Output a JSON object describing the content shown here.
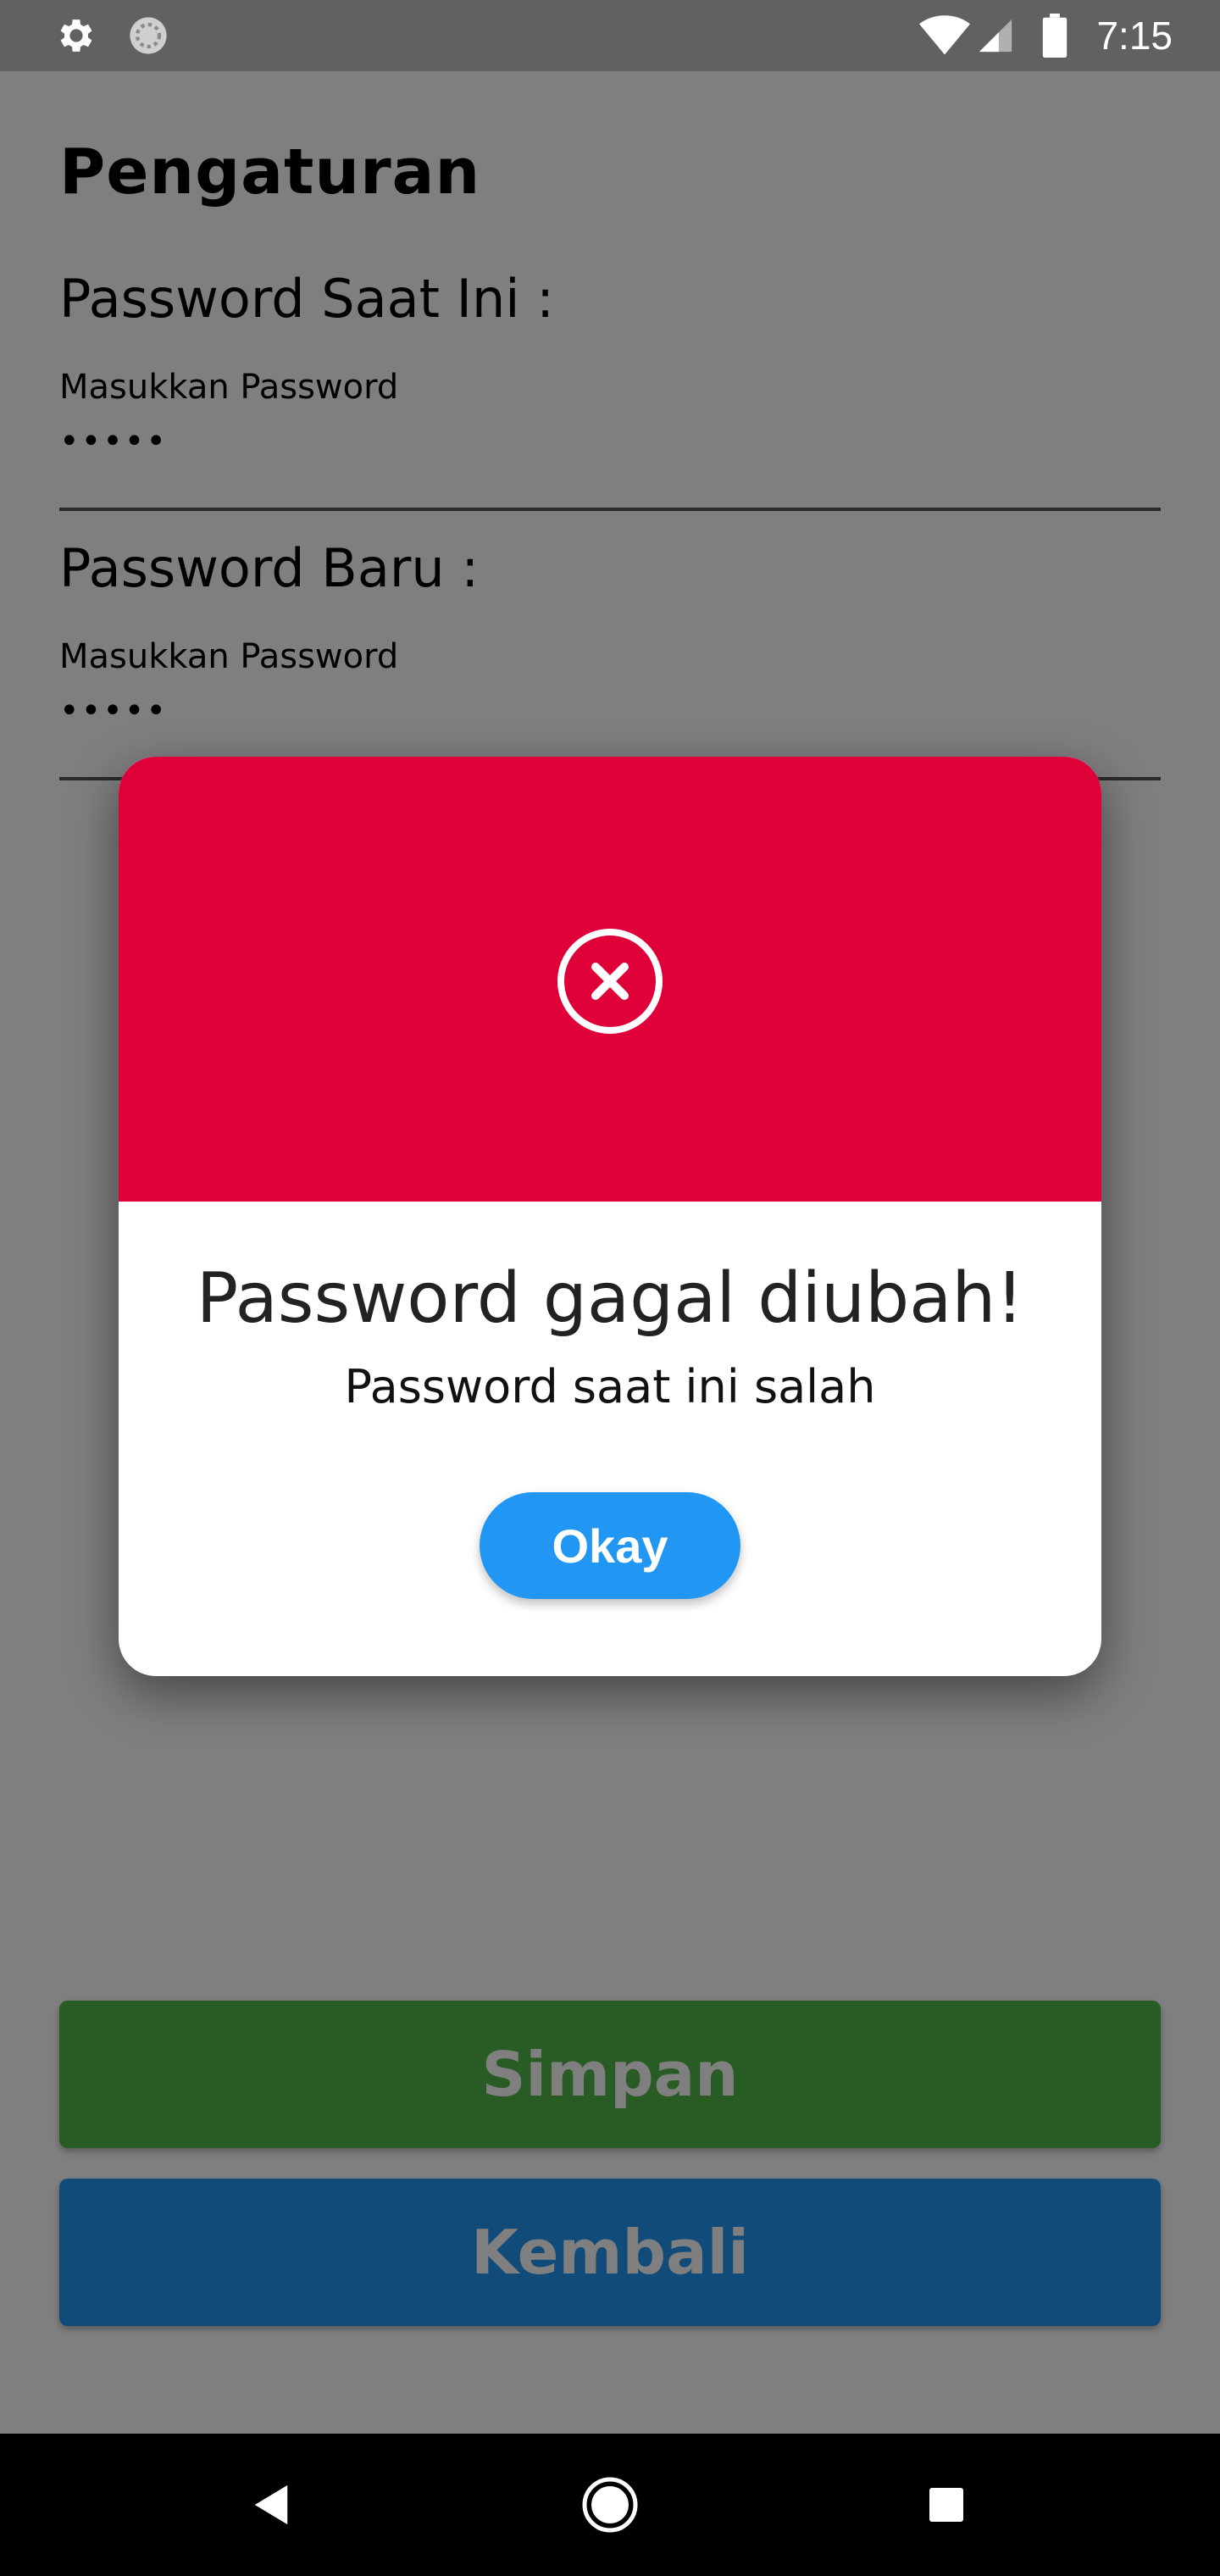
{
  "status_bar": {
    "time": "7:15",
    "icons": [
      "settings-icon",
      "sync-icon",
      "wifi-icon",
      "signal-icon",
      "battery-icon"
    ]
  },
  "page": {
    "title": "Pengaturan",
    "current_password": {
      "label": "Password Saat Ini :",
      "hint": "Masukkan Password",
      "value": "•••••"
    },
    "new_password": {
      "label": "Password Baru :",
      "hint": "Masukkan Password",
      "value": "•••••"
    },
    "save_button": "Simpan",
    "back_button": "Kembali"
  },
  "dialog": {
    "icon": "error-x-icon",
    "title": "Password gagal diubah!",
    "message": "Password saat ini salah",
    "ok_button": "Okay"
  },
  "nav_bar": {
    "icons": [
      "back-icon",
      "home-icon",
      "recents-icon"
    ]
  },
  "colors": {
    "dialog_header": "#DF0039",
    "okay_button": "#2196F3",
    "save_button": "#53B848",
    "back_button": "#2196F3",
    "status_bar": "#616161"
  }
}
